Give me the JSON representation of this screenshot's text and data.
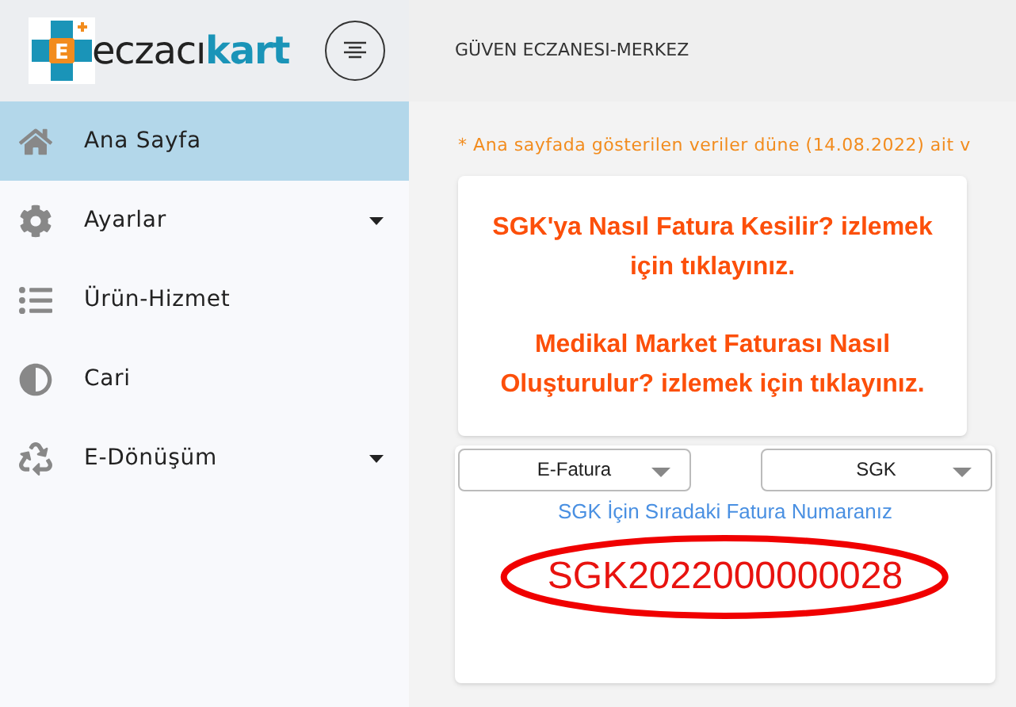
{
  "brand": {
    "prefix": "eczacı",
    "accent": "kart",
    "logo_letter": "E"
  },
  "header": {
    "title": "GÜVEN ECZANESI-MERKEZ"
  },
  "sidebar": {
    "items": [
      {
        "label": "Ana Sayfa",
        "kind": "home",
        "selected": true,
        "has_submenu": false
      },
      {
        "label": "Ayarlar",
        "kind": "gear",
        "selected": false,
        "has_submenu": true
      },
      {
        "label": "Ürün-Hizmet",
        "kind": "list",
        "selected": false,
        "has_submenu": false
      },
      {
        "label": "Cari",
        "kind": "contrast",
        "selected": false,
        "has_submenu": false
      },
      {
        "label": "E-Dönüşüm",
        "kind": "recycle",
        "selected": false,
        "has_submenu": true
      }
    ]
  },
  "notice": "* Ana sayfada gösterilen veriler düne (14.08.2022) ait v",
  "video_links": [
    "SGK'ya Nasıl Fatura Kesilir? izlemek için tıklayınız.",
    "Medikal Market Faturası Nasıl Oluşturulur? izlemek için tıklayınız."
  ],
  "invoice": {
    "type_select": "E-Fatura",
    "target_select": "SGK",
    "label": "SGK İçin Sıradaki Fatura Numaranız",
    "number": "SGK2022000000028",
    "circled": true
  }
}
